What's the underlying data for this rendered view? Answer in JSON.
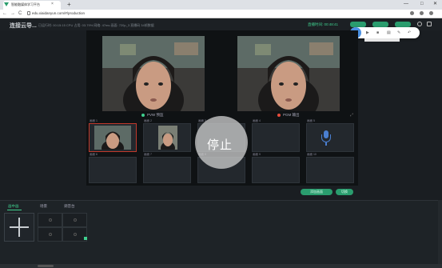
{
  "browser": {
    "tab_title": "智能融媒体学习平台",
    "url": "edu.xiaidanyun.com/#/production",
    "new_tab": "+",
    "tab_close": "×",
    "nav_back": "←",
    "nav_forward": "→",
    "nav_reload": "C",
    "win_min": "—",
    "win_max": "□",
    "win_close": "✕"
  },
  "header": {
    "title": "连接云导...",
    "info": "已运行时: 00:15:15  CPU 占用: 03.79%  网络: 47ms  画面: 720p_3  直播码 34帧数据",
    "live_status": "直播时间: 00:48:41"
  },
  "stage": {
    "pvw_label": "PVW 预监",
    "pgm_label": "PGM 输出",
    "stop_label": "停止",
    "expand_icon": "⤢"
  },
  "sources_row1": [
    {
      "label": "画面 1"
    },
    {
      "label": "画面 2"
    },
    {
      "label": "画面 3"
    },
    {
      "label": "画面 4"
    },
    {
      "label": "画面 5"
    }
  ],
  "sources_row2": [
    {
      "label": "画面 6"
    },
    {
      "label": "画面 7"
    },
    {
      "label": "画面 8"
    },
    {
      "label": "画面 9"
    },
    {
      "label": "画面 10"
    }
  ],
  "actions": {
    "btn1": "添加画面",
    "btn2": "切换"
  },
  "bottom": {
    "tabs": [
      "画中画",
      "场景",
      "调音台"
    ]
  },
  "colors": {
    "accent": "#3fcf8e",
    "pvw_dot": "#3fcf8e",
    "pgm_dot": "#e74c3c",
    "selected_border": "#c0392b"
  }
}
